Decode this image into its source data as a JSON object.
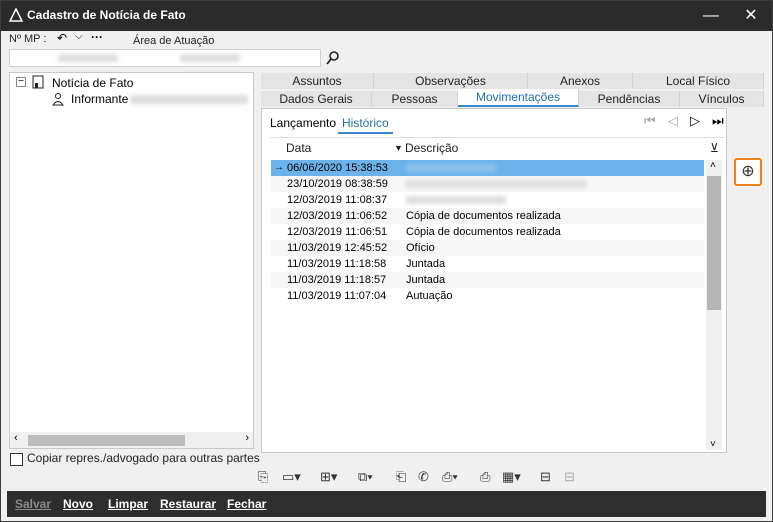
{
  "window": {
    "title": "Cadastro de Notícia de Fato",
    "controls": [
      "—",
      "✕"
    ]
  },
  "header": {
    "mp_label": "Nº MP :",
    "area_label": "Área de Atuação",
    "search_icon": "search-icon"
  },
  "tree": {
    "root": "Notícia de Fato",
    "child": "Informante"
  },
  "tabs": {
    "row1": [
      "Assuntos",
      "Observações",
      "Anexos",
      "Local Físico"
    ],
    "row2": [
      "Dados Gerais",
      "Pessoas",
      "Movimentações",
      "Pendências",
      "Vínculos"
    ],
    "active": "Movimentações"
  },
  "subtabs": {
    "items": [
      "Lançamento",
      "Histórico"
    ],
    "active": "Histórico"
  },
  "grid": {
    "columns": [
      "Data",
      "Descrição"
    ],
    "rows": [
      {
        "date": "06/06/2020 15:38:53",
        "desc": ""
      },
      {
        "date": "23/10/2019 08:38:59",
        "desc": ""
      },
      {
        "date": "12/03/2019 11:08:37",
        "desc": ""
      },
      {
        "date": "12/03/2019 11:06:52",
        "desc": "Cópia de documentos realizada"
      },
      {
        "date": "12/03/2019 11:06:51",
        "desc": "Cópia de documentos realizada"
      },
      {
        "date": "11/03/2019 12:45:52",
        "desc": "Ofício"
      },
      {
        "date": "11/03/2019 11:18:58",
        "desc": "Juntada"
      },
      {
        "date": "11/03/2019 11:18:57",
        "desc": "Juntada"
      },
      {
        "date": "11/03/2019 11:07:04",
        "desc": "Autuação"
      }
    ]
  },
  "checkbox_label": "Copiar repres./advogado para outras partes",
  "footer": {
    "save": "Salvar",
    "new": "Novo",
    "clear": "Limpar",
    "restore": "Restaurar",
    "close": "Fechar"
  }
}
